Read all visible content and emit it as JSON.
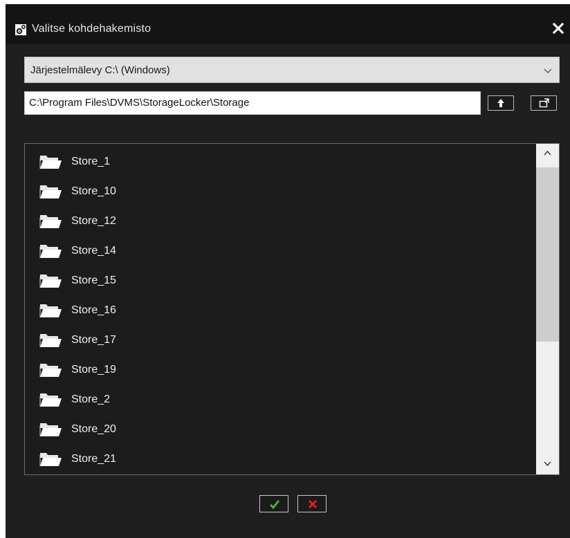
{
  "window": {
    "title": "Valitse kohdehakemisto",
    "title_icon": "settings-gears-icon",
    "close_icon": "close-icon"
  },
  "drive": {
    "selected": "Järjestelmälevy C:\\ (Windows)"
  },
  "path": {
    "value": "C:\\Program Files\\DVMS\\StorageLocker\\Storage",
    "up_icon": "arrow-up-icon",
    "new_folder_icon": "new-folder-icon"
  },
  "folders": [
    {
      "label": "Store_1"
    },
    {
      "label": "Store_10"
    },
    {
      "label": "Store_12"
    },
    {
      "label": "Store_14"
    },
    {
      "label": "Store_15"
    },
    {
      "label": "Store_16"
    },
    {
      "label": "Store_17"
    },
    {
      "label": "Store_19"
    },
    {
      "label": "Store_2"
    },
    {
      "label": "Store_20"
    },
    {
      "label": "Store_21"
    }
  ],
  "footer": {
    "ok_icon": "check-icon",
    "cancel_icon": "x-icon"
  },
  "colors": {
    "dialog_bg": "#1f1f1f",
    "ok_green": "#3cb83c",
    "cancel_red": "#e02020"
  }
}
